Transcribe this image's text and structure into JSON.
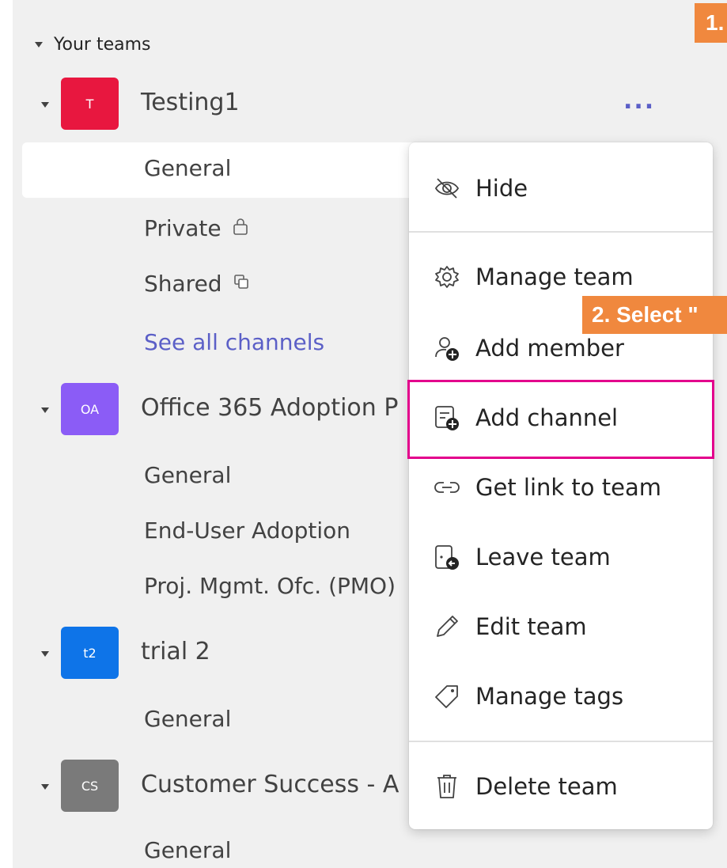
{
  "section": {
    "label": "Your teams"
  },
  "teams": [
    {
      "initials": "T",
      "name": "Testing1",
      "color": "#e8173f",
      "channels": [
        "General",
        "Private",
        "Shared",
        "See all channels"
      ]
    },
    {
      "initials": "OA",
      "name": "Office 365 Adoption P",
      "color": "#8b5cf6",
      "channels": [
        "General",
        "End-User Adoption",
        "Proj. Mgmt. Ofc. (PMO)"
      ]
    },
    {
      "initials": "t2",
      "name": "trial 2",
      "color": "#0e74e8",
      "channels": [
        "General"
      ]
    },
    {
      "initials": "CS",
      "name": "Customer Success - A",
      "color": "#7a7a7a",
      "channels": [
        "General"
      ]
    }
  ],
  "more_options": "...",
  "menu": {
    "hide": "Hide",
    "manage_team": "Manage team",
    "add_member": "Add member",
    "add_channel": "Add channel",
    "get_link": "Get link to team",
    "leave_team": "Leave team",
    "edit_team": "Edit team",
    "manage_tags": "Manage tags",
    "delete_team": "Delete team"
  },
  "callouts": {
    "step1": "1.",
    "step2": "2. Select \""
  },
  "colors": {
    "accent": "#5b5fc7",
    "callout": "#f0883e",
    "highlight": "#e3008c"
  }
}
